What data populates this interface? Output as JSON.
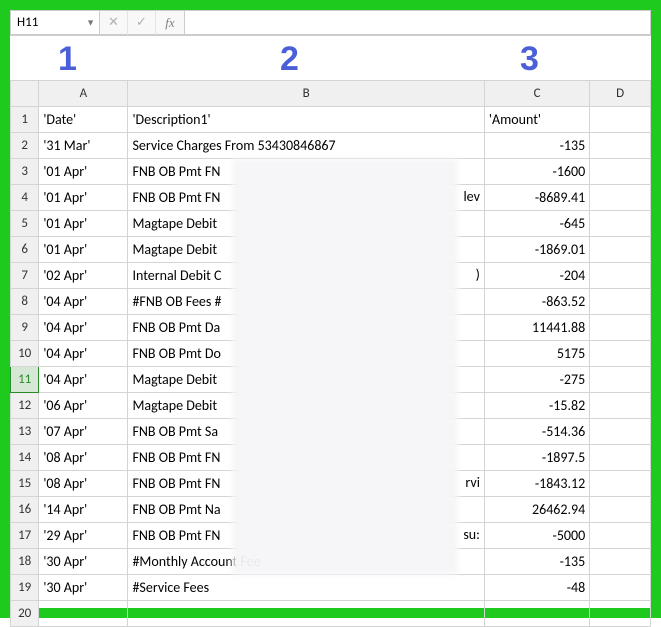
{
  "formula_bar": {
    "cell_ref": "H11",
    "cancel_glyph": "✕",
    "confirm_glyph": "✓",
    "fx_label": "fx",
    "value": ""
  },
  "overlay_numbers": {
    "n1": "1",
    "n2": "2",
    "n3": "3"
  },
  "columns": {
    "A": "A",
    "B": "B",
    "C": "C",
    "D": "D"
  },
  "rows": [
    {
      "n": "1",
      "a": "'Date'",
      "b": "'Description1'",
      "c": "'Amount'"
    },
    {
      "n": "2",
      "a": "'31 Mar'",
      "b": "Service Charges From 53430846867",
      "c": "-135"
    },
    {
      "n": "3",
      "a": "'01 Apr'",
      "b": "FNB OB Pmt FN",
      "c": "-1600"
    },
    {
      "n": "4",
      "a": "'01 Apr'",
      "b": "FNB OB Pmt FN",
      "c": "-8689.41",
      "frag": "lev"
    },
    {
      "n": "5",
      "a": "'01 Apr'",
      "b": "Magtape Debit",
      "c": "-645"
    },
    {
      "n": "6",
      "a": "'01 Apr'",
      "b": "Magtape Debit",
      "c": "-1869.01"
    },
    {
      "n": "7",
      "a": "'02 Apr'",
      "b": "Internal Debit C",
      "c": "-204",
      "frag": ")"
    },
    {
      "n": "8",
      "a": "'04 Apr'",
      "b": "#FNB OB Fees #",
      "c": "-863.52"
    },
    {
      "n": "9",
      "a": "'04 Apr'",
      "b": "FNB OB Pmt Da",
      "c": "11441.88"
    },
    {
      "n": "10",
      "a": "'04 Apr'",
      "b": "FNB OB Pmt Do",
      "c": "5175"
    },
    {
      "n": "11",
      "a": "'04 Apr'",
      "b": "Magtape Debit",
      "c": "-275"
    },
    {
      "n": "12",
      "a": "'06 Apr'",
      "b": "Magtape Debit",
      "c": "-15.82"
    },
    {
      "n": "13",
      "a": "'07 Apr'",
      "b": "FNB OB Pmt Sa",
      "c": "-514.36"
    },
    {
      "n": "14",
      "a": "'08 Apr'",
      "b": "FNB OB Pmt FN",
      "c": "-1897.5"
    },
    {
      "n": "15",
      "a": "'08 Apr'",
      "b": "FNB OB Pmt FN",
      "c": "-1843.12",
      "frag": "rvi"
    },
    {
      "n": "16",
      "a": "'14 Apr'",
      "b": "FNB OB Pmt Na",
      "c": "26462.94"
    },
    {
      "n": "17",
      "a": "'29 Apr'",
      "b": "FNB OB Pmt FN",
      "c": "-5000",
      "frag": "su:"
    },
    {
      "n": "18",
      "a": "'30 Apr'",
      "b": "#Monthly Account Fee",
      "c": "-135"
    },
    {
      "n": "19",
      "a": "'30 Apr'",
      "b": "#Service Fees",
      "c": "-48"
    },
    {
      "n": "20",
      "a": "",
      "b": "",
      "c": ""
    }
  ],
  "selected_row_header": "11"
}
